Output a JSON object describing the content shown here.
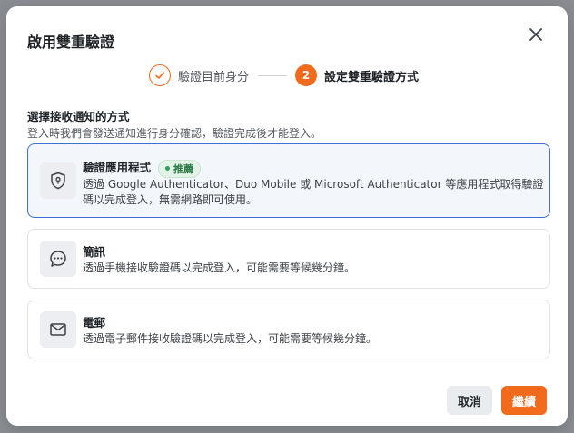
{
  "dialog": {
    "title": "啟用雙重驗證"
  },
  "stepper": {
    "steps": [
      {
        "number": "1",
        "label": "驗證目前身分",
        "status": "done"
      },
      {
        "number": "2",
        "label": "設定雙重驗證方式",
        "status": "active"
      }
    ]
  },
  "section": {
    "title": "選擇接收通知的方式",
    "description": "登入時我們會發送通知進行身分確認，驗證完成後才能登入。"
  },
  "options": [
    {
      "title": "驗證應用程式",
      "badge": "推薦",
      "description": "透過 Google Authenticator、Duo Mobile 或 Microsoft Authenticator 等應用程式取得驗證碼以完成登入，無需網路即可使用。",
      "icon": "shield-lock-icon",
      "selected": true
    },
    {
      "title": "簡訊",
      "description": "透過手機接收驗證碼以完成登入，可能需要等候幾分鐘。",
      "icon": "chat-bubble-icon",
      "selected": false
    },
    {
      "title": "電郵",
      "description": "透過電子郵件接收驗證碼以完成登入，可能需要等候幾分鐘。",
      "icon": "mail-icon",
      "selected": false
    }
  ],
  "buttons": {
    "cancel": "取消",
    "continue": "繼續"
  },
  "colors": {
    "accent": "#f26b1d",
    "selected_border": "#3a6fd8",
    "badge_bg": "#e3f3e8",
    "badge_text": "#2a7a45"
  }
}
